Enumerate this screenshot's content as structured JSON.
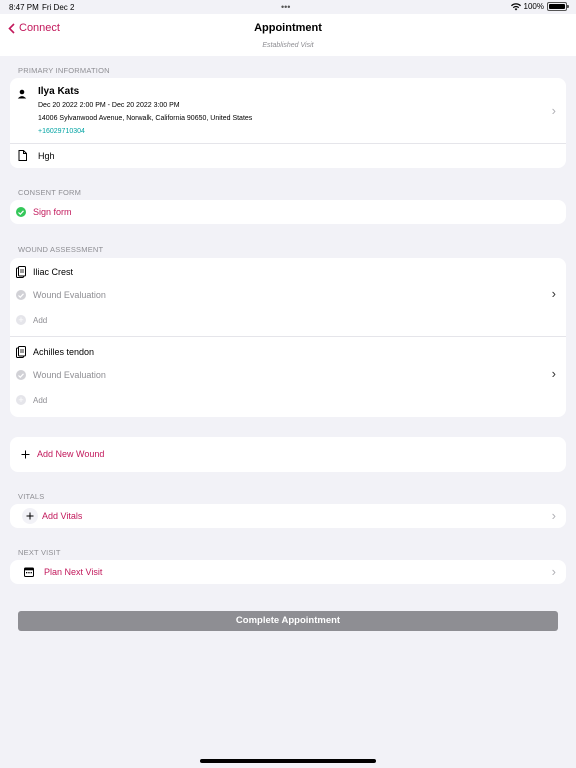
{
  "status": {
    "time": "8:47 PM",
    "date": "Fri Dec 2",
    "battery": "100%"
  },
  "nav": {
    "back_label": "Connect",
    "title": "Appointment",
    "subtitle": "Established Visit"
  },
  "primary": {
    "section": "PRIMARY INFORMATION",
    "name": "Ilya Kats",
    "datetime": "Dec 20 2022 2:00 PM - Dec 20 2022 3:00 PM",
    "address": "14006 Sylvanwood Avenue, Norwalk, California 90650, United States",
    "phone": "+16029710304",
    "note": "Hgh"
  },
  "consent": {
    "section": "CONSENT FORM",
    "sign_label": "Sign form"
  },
  "wounds": {
    "section": "WOUND ASSESSMENT",
    "items": [
      {
        "name": "Iliac Crest",
        "evaluation": "Wound Evaluation",
        "add": "Add"
      },
      {
        "name": "Achilles tendon",
        "evaluation": "Wound Evaluation",
        "add": "Add"
      }
    ],
    "add_new": "Add New Wound"
  },
  "vitals": {
    "section": "VITALS",
    "add_label": "Add Vitals"
  },
  "next_visit": {
    "section": "NEXT VISIT",
    "plan_label": "Plan Next Visit"
  },
  "complete_label": "Complete Appointment",
  "colors": {
    "accent": "#c2185b",
    "phone": "#00a3a3",
    "complete_bg": "#8e8e93",
    "check": "#34c759"
  }
}
